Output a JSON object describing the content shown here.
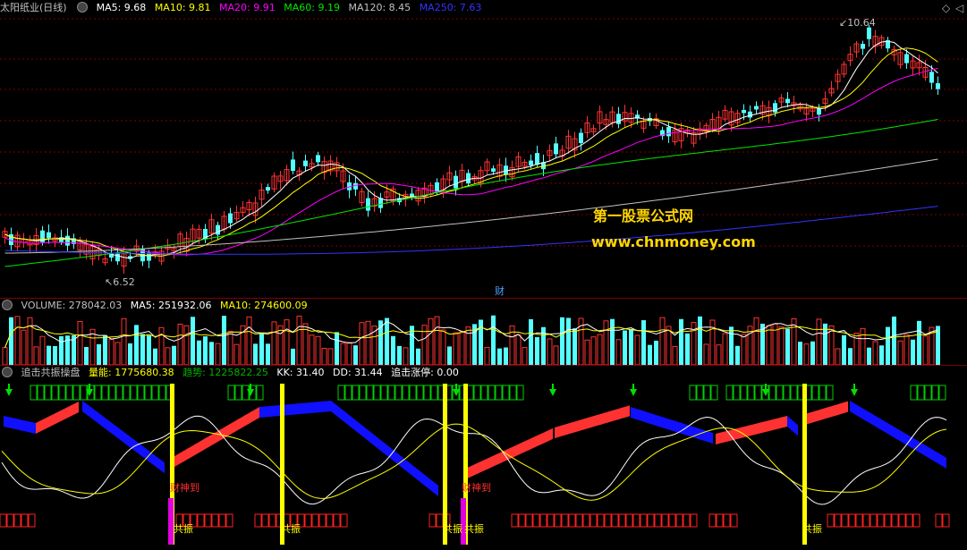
{
  "main": {
    "stock_title": "太阳纸业(日线)",
    "ma5": "MA5: 9.68",
    "ma10": "MA10: 9.81",
    "ma20": "MA20: 9.91",
    "ma60": "MA60: 9.19",
    "ma120": "MA120: 8.45",
    "ma250": "MA250: 7.63",
    "high_mark": "10.64",
    "low_mark": "6.52",
    "cai_mark": "财",
    "watermark_cn": "第一股票公式网",
    "watermark_url": "www.chnmoney.com"
  },
  "volume": {
    "label": "VOLUME: 278042.03",
    "ma5": "MA5: 251932.06",
    "ma10": "MA10: 274600.09"
  },
  "indicator": {
    "name": "追击共振操盘",
    "liangneng": "量能: 1775680.38",
    "qushi": "趋势: 1225822.25",
    "kk": "KK: 31.40",
    "dd": "DD: 31.44",
    "zhuiji": "追击涨停: 0.00",
    "caishen": "财神到",
    "gongzhen": "共振"
  },
  "colors": {
    "up": "#ff3232",
    "down": "#54ffff",
    "ma5": "#ffffff",
    "ma10": "#ffff00",
    "ma20": "#ff00ff",
    "ma60": "#00e600",
    "ma120": "#c0c0c0",
    "ma250": "#3333ff"
  }
}
